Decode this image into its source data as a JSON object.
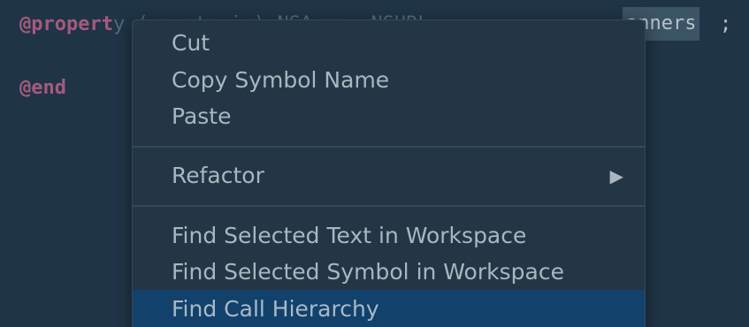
{
  "editor": {
    "line1_keyword": "@propert",
    "line1_obscured": "y (nonatomic) NSArray<NSURL",
    "line1_selected": "anners",
    "line1_semicolon": ";",
    "line2_keyword": "@end"
  },
  "context_menu": {
    "items": [
      {
        "label": "Cut"
      },
      {
        "label": "Copy Symbol Name"
      },
      {
        "label": "Paste"
      },
      {
        "label": "Refactor",
        "submenu_icon": "triangle-right-icon"
      },
      {
        "label": "Find Selected Text in Workspace"
      },
      {
        "label": "Find Selected Symbol in Workspace"
      },
      {
        "label": "Find Call Hierarchy"
      }
    ],
    "highlighted_item": "Find Call Hierarchy"
  },
  "colors": {
    "editor_background": "#1f3446",
    "menu_background": "#243646",
    "highlight": "#12416c",
    "keyword": "#a45a7e"
  }
}
